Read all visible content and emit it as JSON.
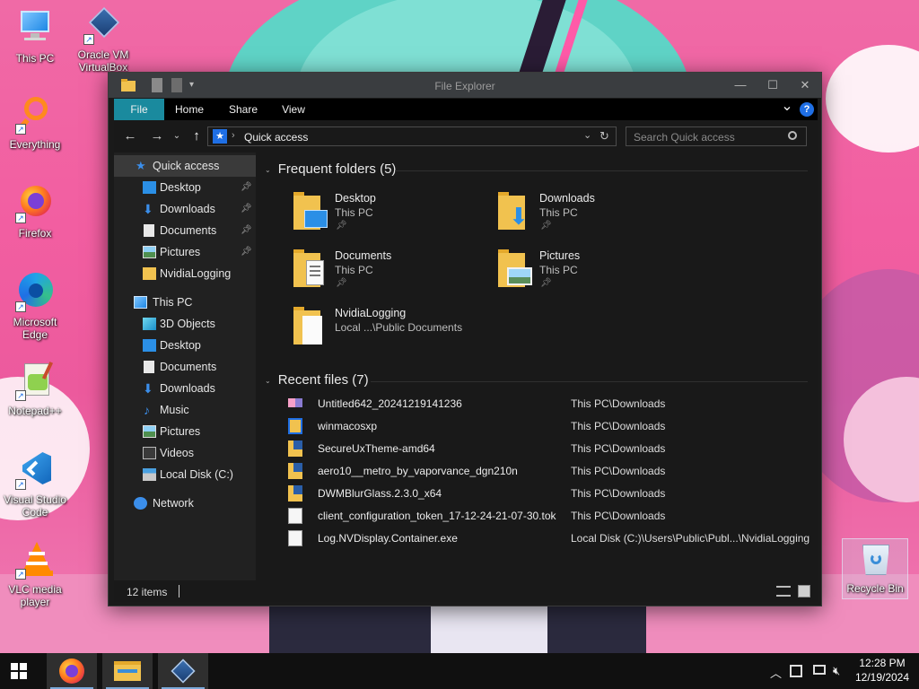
{
  "desktop": {
    "icons": [
      {
        "label": "This PC",
        "icon": "computer-icon"
      },
      {
        "label": "Oracle VM VirtualBox",
        "icon": "virtualbox-icon"
      },
      {
        "label": "Everything",
        "icon": "everything-search-icon"
      },
      {
        "label": "Firefox",
        "icon": "firefox-icon"
      },
      {
        "label": "Microsoft Edge",
        "icon": "edge-icon"
      },
      {
        "label": "Notepad++",
        "icon": "notepadpp-icon"
      },
      {
        "label": "Visual Studio Code",
        "icon": "vscode-icon"
      },
      {
        "label": "VLC media player",
        "icon": "vlc-icon"
      },
      {
        "label": "Recycle Bin",
        "icon": "recycle-bin-icon"
      }
    ]
  },
  "window": {
    "title": "File Explorer",
    "controls": {
      "minimize": "—",
      "maximize": "☐",
      "close": "✕"
    }
  },
  "ribbon": {
    "tabs": [
      "File",
      "Home",
      "Share",
      "View"
    ],
    "active_tab": "File",
    "collapse_glyph": "⌄",
    "help_glyph": "?"
  },
  "address": {
    "path": "Quick access",
    "search_placeholder": "Search Quick access"
  },
  "nav_pane": {
    "quick_access": "Quick access",
    "pinned": [
      {
        "label": "Desktop",
        "pinned": true
      },
      {
        "label": "Downloads",
        "pinned": true
      },
      {
        "label": "Documents",
        "pinned": true
      },
      {
        "label": "Pictures",
        "pinned": true
      },
      {
        "label": "NvidiaLogging",
        "pinned": false
      }
    ],
    "this_pc": "This PC",
    "this_pc_items": [
      "3D Objects",
      "Desktop",
      "Documents",
      "Downloads",
      "Music",
      "Pictures",
      "Videos",
      "Local Disk (C:)"
    ],
    "network": "Network"
  },
  "frequent": {
    "heading": "Frequent folders (5)",
    "folders": [
      {
        "name": "Desktop",
        "location": "This PC",
        "pinned": true
      },
      {
        "name": "Downloads",
        "location": "This PC",
        "pinned": true
      },
      {
        "name": "Documents",
        "location": "This PC",
        "pinned": true
      },
      {
        "name": "Pictures",
        "location": "This PC",
        "pinned": true
      },
      {
        "name": "NvidiaLogging",
        "location": "Local ...\\Public Documents",
        "pinned": false
      }
    ]
  },
  "recent": {
    "heading": "Recent files (7)",
    "files": [
      {
        "name": "Untitled642_20241219141236",
        "path": "This PC\\Downloads",
        "icon": "image-file-icon"
      },
      {
        "name": "winmacosxp",
        "path": "This PC\\Downloads",
        "icon": "iso-file-icon"
      },
      {
        "name": "SecureUxTheme-amd64",
        "path": "This PC\\Downloads",
        "icon": "zip-folder-icon"
      },
      {
        "name": "aero10__metro_by_vaporvance_dgn210n",
        "path": "This PC\\Downloads",
        "icon": "zip-folder-icon"
      },
      {
        "name": "DWMBlurGlass.2.3.0_x64",
        "path": "This PC\\Downloads",
        "icon": "zip-folder-icon"
      },
      {
        "name": "client_configuration_token_17-12-24-21-07-30.tok",
        "path": "This PC\\Downloads",
        "icon": "blank-file-icon"
      },
      {
        "name": "Log.NVDisplay.Container.exe",
        "path": "Local Disk (C:)\\Users\\Public\\Publ...\\NvidiaLogging",
        "icon": "text-file-icon"
      }
    ]
  },
  "status": {
    "items": "12 items"
  },
  "taskbar": {
    "apps": [
      "Firefox",
      "File Explorer",
      "Oracle VM VirtualBox"
    ],
    "time": "12:28 PM",
    "date": "12/19/2024"
  }
}
